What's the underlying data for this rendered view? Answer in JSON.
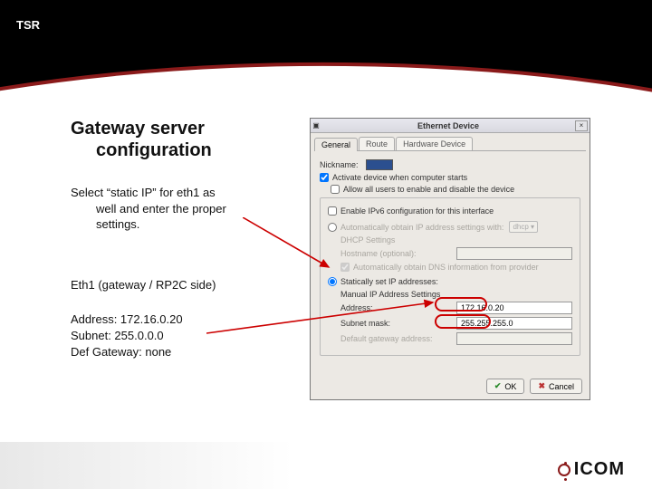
{
  "header": {
    "tsr": "TSR"
  },
  "slide": {
    "title_line1": "Gateway server",
    "title_line2": "configuration",
    "instruction_line1": "Select “static IP” for eth1 as",
    "instruction_line2": "well and enter the proper",
    "instruction_line3": "settings.",
    "eth_label": "Eth1 (gateway / RP2C side)",
    "addr": "Address: 172.16.0.20",
    "subnet": "Subnet: 255.0.0.0",
    "gw": "Def Gateway: none"
  },
  "dialog": {
    "title": "Ethernet Device",
    "close": "×",
    "tabs": {
      "general": "General",
      "route": "Route",
      "hardware": "Hardware Device"
    },
    "nickname_label": "Nickname:",
    "activate": "Activate device when computer starts",
    "allow_all": "Allow all users to enable and disable the device",
    "enable_ipv6": "Enable IPv6 configuration for this interface",
    "auto_ip": "Automatically obtain IP address settings with:",
    "auto_sel": "dhcp",
    "dhcp_heading": "DHCP Settings",
    "hostname_label": "Hostname (optional):",
    "auto_dns": "Automatically obtain DNS information from provider",
    "static_ip": "Statically set IP addresses:",
    "manual_heading": "Manual IP Address Settings",
    "addr_label": "Address:",
    "addr_value": "172.16.0.20",
    "mask_label": "Subnet mask:",
    "mask_value": "255.255.255.0",
    "gw_label": "Default gateway address:",
    "gw_value": "",
    "ok": "OK",
    "cancel": "Cancel"
  },
  "footer": {
    "brand": "ICOM"
  }
}
